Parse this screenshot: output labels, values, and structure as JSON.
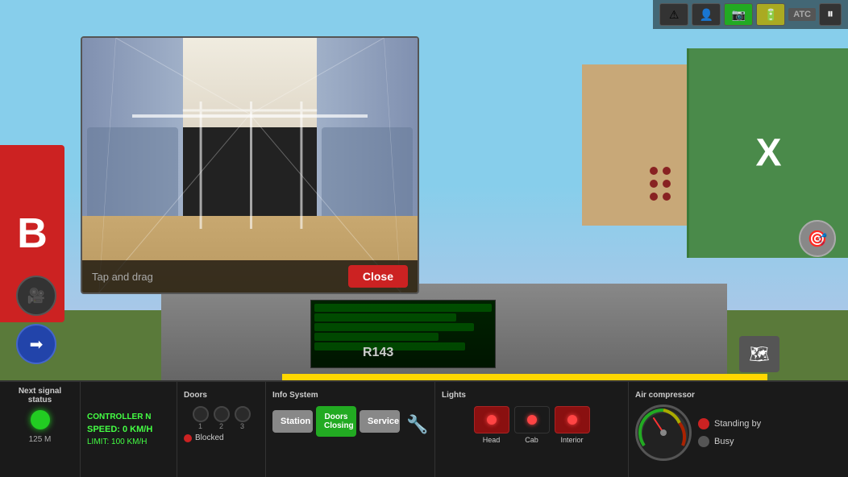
{
  "topbar": {
    "warning_icon": "⚠",
    "person_icon": "👤",
    "camera_icon": "📷",
    "battery_icon": "🔋",
    "atc_label": "ATC",
    "pause_icon": "⏸"
  },
  "left_panel": {
    "label": "B"
  },
  "interior_popup": {
    "tap_drag_label": "Tap and drag",
    "close_label": "Close"
  },
  "nav_button": {
    "icon": "🎯"
  },
  "bottom_panel": {
    "signal": {
      "title": "Next signal status",
      "distance": "125 M"
    },
    "controller": {
      "label": "CONTROLLER N",
      "speed": "SPEED: 0 KM/H",
      "limit": "LIMIT: 100 KM/H"
    },
    "doors": {
      "title": "Doors",
      "numbers": [
        "1",
        "2",
        "3"
      ],
      "blocked_label": "Blocked"
    },
    "info_system": {
      "title": "Info System",
      "station_label": "Station",
      "doors_closing_label": "Doors Closing",
      "service_label": "Service"
    },
    "lights": {
      "title": "Lights",
      "head_label": "Head",
      "cab_label": "Cab",
      "interior_label": "Interior"
    },
    "air_compressor": {
      "title": "Air compressor",
      "standing_by_label": "Standing by",
      "busy_label": "Busy"
    }
  },
  "train_id": "R143"
}
